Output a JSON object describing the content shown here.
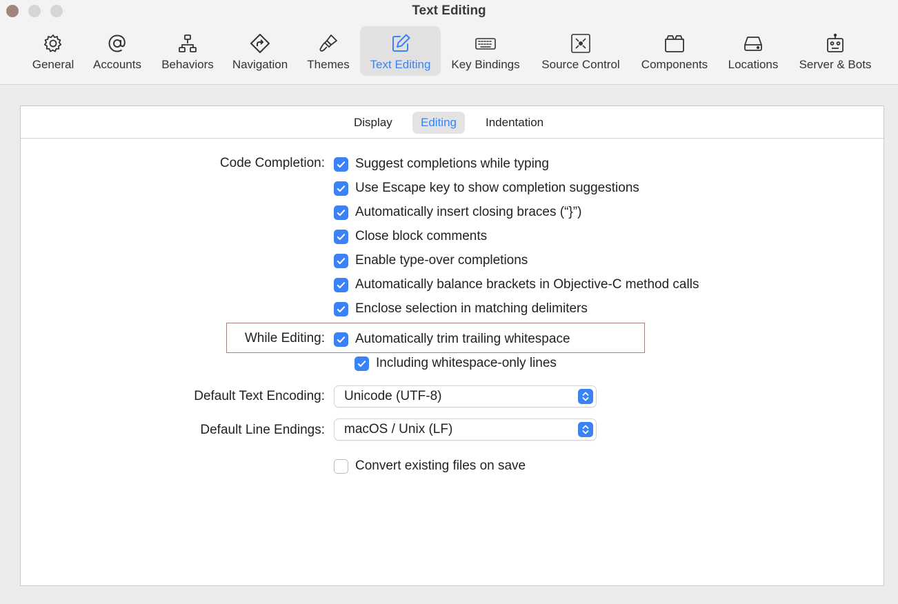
{
  "window": {
    "title": "Text Editing"
  },
  "toolbar": {
    "items": [
      {
        "label": "General",
        "icon": "gear-icon"
      },
      {
        "label": "Accounts",
        "icon": "at-icon"
      },
      {
        "label": "Behaviors",
        "icon": "hierarchy-icon"
      },
      {
        "label": "Navigation",
        "icon": "navigation-icon"
      },
      {
        "label": "Themes",
        "icon": "paintbrush-icon"
      },
      {
        "label": "Text Editing",
        "icon": "pencil-square-icon",
        "active": true
      },
      {
        "label": "Key Bindings",
        "icon": "keyboard-icon"
      },
      {
        "label": "Source Control",
        "icon": "source-control-icon"
      },
      {
        "label": "Components",
        "icon": "components-icon"
      },
      {
        "label": "Locations",
        "icon": "drive-icon"
      },
      {
        "label": "Server & Bots",
        "icon": "robot-icon"
      }
    ]
  },
  "tabs": {
    "display": "Display",
    "editing": "Editing",
    "indentation": "Indentation",
    "selected": "Editing"
  },
  "code_completion": {
    "label": "Code Completion:",
    "options": [
      {
        "text": "Suggest completions while typing",
        "checked": true
      },
      {
        "text": "Use Escape key to show completion suggestions",
        "checked": true
      },
      {
        "text": "Automatically insert closing braces (“}”)",
        "checked": true
      },
      {
        "text": "Close block comments",
        "checked": true
      },
      {
        "text": "Enable type-over completions",
        "checked": true
      },
      {
        "text": "Automatically balance brackets in Objective-C method calls",
        "checked": true
      },
      {
        "text": "Enclose selection in matching delimiters",
        "checked": true
      }
    ]
  },
  "while_editing": {
    "label": "While Editing:",
    "trim": {
      "text": "Automatically trim trailing whitespace",
      "checked": true
    },
    "whitespace_only": {
      "text": "Including whitespace-only lines",
      "checked": true
    }
  },
  "encoding": {
    "label": "Default Text Encoding:",
    "value": "Unicode (UTF-8)"
  },
  "line_endings": {
    "label": "Default Line Endings:",
    "value": "macOS / Unix (LF)"
  },
  "convert": {
    "text": "Convert existing files on save",
    "checked": false
  },
  "colors": {
    "accent": "#3b82f6",
    "highlight_border": "#a87f7a",
    "close_button": "#a2857f"
  }
}
